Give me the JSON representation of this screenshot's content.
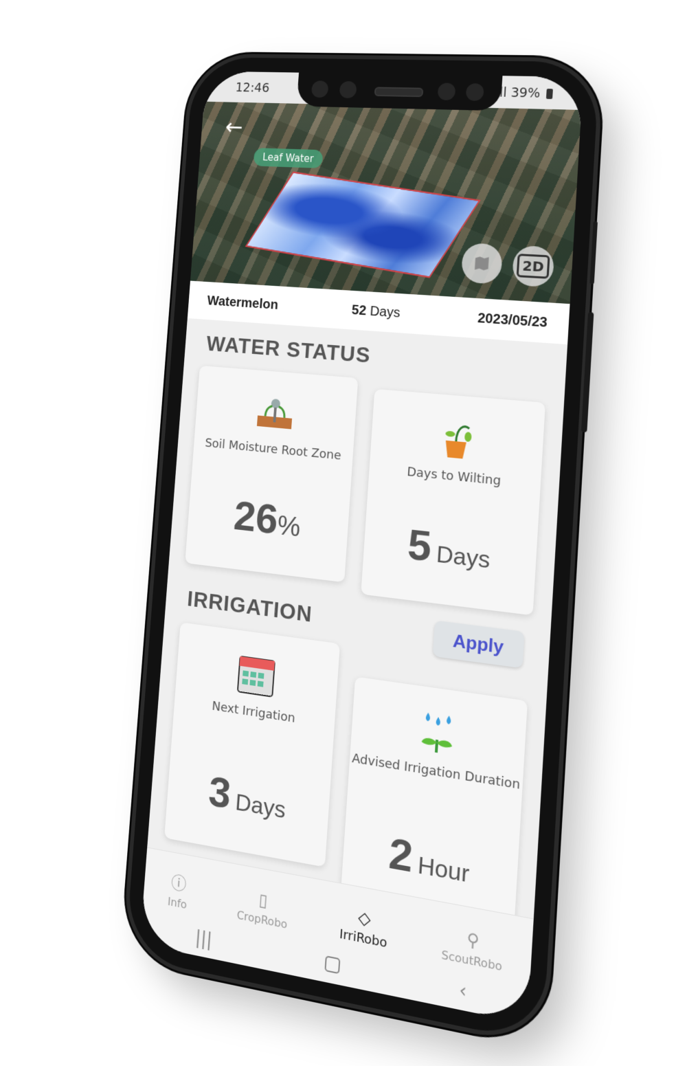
{
  "status_bar": {
    "time": "12:46",
    "battery": "39%",
    "signal": "H+ .ıll"
  },
  "map": {
    "layer_chip": "Leaf Water",
    "back_icon": "back-arrow-icon",
    "map_toggle_icon": "map-icon",
    "view_mode": "2D"
  },
  "crop_info": {
    "crop": "Watermelon",
    "days_num": "52",
    "days_label": "Days",
    "date": "2023/05/23"
  },
  "water_status": {
    "title": "WATER STATUS",
    "soil": {
      "label": "Soil Moisture Root Zone",
      "value": "26",
      "unit": "%"
    },
    "wilting": {
      "label": "Days to Wilting",
      "value": "5",
      "unit": "Days"
    }
  },
  "irrigation": {
    "title": "IRRIGATION",
    "apply_label": "Apply",
    "next": {
      "label": "Next Irrigation",
      "value": "3",
      "unit": "Days"
    },
    "duration": {
      "label": "Advised Irrigation Duration",
      "value": "2",
      "unit": "Hour"
    }
  },
  "bottom_nav": {
    "items": [
      {
        "label": "Info",
        "icon": "info-icon"
      },
      {
        "label": "CropRobo",
        "icon": "map-icon"
      },
      {
        "label": "IrriRobo",
        "icon": "water-drop-icon"
      },
      {
        "label": "ScoutRobo",
        "icon": "search-icon"
      }
    ],
    "active": "IrriRobo"
  },
  "colors": {
    "apply_text": "#4b53cc",
    "chip_bg": "#46a078",
    "field_border": "#d8434a"
  }
}
